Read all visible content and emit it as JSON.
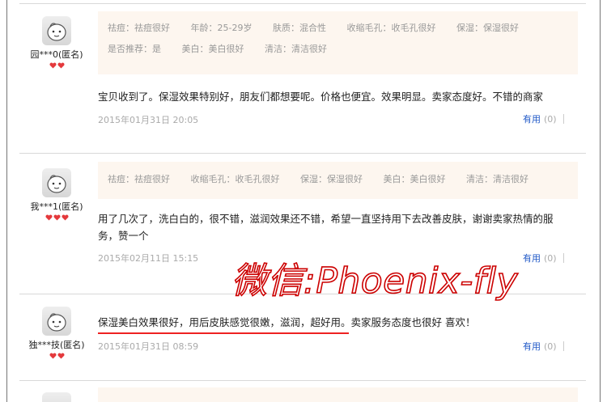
{
  "reviews": [
    {
      "user": "园***0(匿名)",
      "hearts": 2,
      "tag_rows": [
        [
          "祛痘：祛痘很好",
          "年龄：25-29岁",
          "肤质：混合性",
          "收缩毛孔：收毛孔很好",
          "保湿：保湿很好"
        ],
        [
          "是否推荐：是",
          "美白：美白很好",
          "清洁：清洁很好"
        ]
      ],
      "content": "宝贝收到了。保湿效果特别好，朋友们都想要呢。价格也便宜。效果明显。卖家态度好。不错的商家",
      "date": "2015年01月31日 20:05",
      "useful_label": "有用",
      "useful_count": "(0)"
    },
    {
      "user": "我***1(匿名)",
      "hearts": 3,
      "tag_rows": [
        [
          "祛痘：祛痘很好",
          "收缩毛孔：收毛孔很好",
          "保湿：保湿很好",
          "美白：美白很好",
          "清洁：清洁很好"
        ]
      ],
      "content": "用了几次了，洗白白的，很不错，滋润效果还不错，希望一直坚持用下去改善皮肤，谢谢卖家热情的服务，赞一个",
      "date": "2015年02月11日 15:15",
      "useful_label": "有用",
      "useful_count": "(0)"
    },
    {
      "user": "独***技(匿名)",
      "hearts": 2,
      "tag_rows": [],
      "content": "保湿美白效果很好，用后皮肤感觉很嫩，滋润，超好用。卖家服务态度也很好 喜欢！",
      "date": "2015年01月31日 08:59",
      "useful_label": "有用",
      "useful_count": "(0)"
    }
  ],
  "watermark": "微信:Phoenix-fly",
  "colors": {
    "heart": "#e4393c",
    "useful": "#1f58c7",
    "tag_bg": "#fdf6ef",
    "underline": "#e22222",
    "watermark": "#cc0000"
  }
}
